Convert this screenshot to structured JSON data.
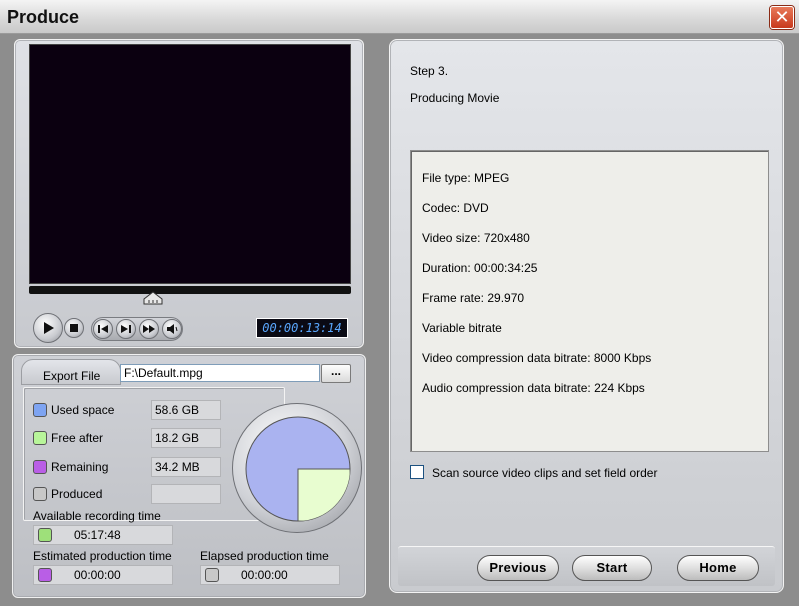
{
  "window": {
    "title": "Produce",
    "close_label": "✕"
  },
  "player": {
    "timecode": "00:00:13:14",
    "buttons": [
      "play-icon",
      "stop-icon",
      "previous-frame-icon",
      "next-frame-icon",
      "fast-forward-icon",
      "volume-icon"
    ]
  },
  "export": {
    "label": "Export File",
    "path": "F:\\Default.mpg",
    "browse_label": "..."
  },
  "disk": {
    "used_space": {
      "label": "Used space",
      "value": "58.6  GB",
      "color": "#7ea4f2"
    },
    "free_after": {
      "label": "Free after",
      "value": "18.2  GB",
      "color": "#b8f59a"
    },
    "remaining": {
      "label": "Remaining",
      "value": "34.2  MB",
      "color": "#b95ee6"
    },
    "produced": {
      "label": "Produced",
      "value": "",
      "color": "#c8c8c8"
    },
    "pie": {
      "used_fraction": 0.75,
      "free_fraction": 0.25,
      "used_color": "#aab3f0",
      "free_color": "#e8fdd0"
    }
  },
  "times": {
    "available_label": "Available recording time",
    "available_value": "05:17:48",
    "available_color": "#9ee07a",
    "estimated_label": "Estimated production time",
    "estimated_value": "00:00:00",
    "estimated_color": "#b95ee6",
    "elapsed_label": "Elapsed production time",
    "elapsed_value": "00:00:00",
    "elapsed_color": "#c8c8c8"
  },
  "wizard": {
    "step": "Step 3.",
    "title": "Producing Movie",
    "info": [
      "File type: MPEG",
      "Codec: DVD",
      "Video size: 720x480",
      "Duration: 00:00:34:25",
      "Frame rate: 29.970",
      "Variable bitrate",
      "Video compression data bitrate: 8000 Kbps",
      "Audio compression data bitrate: 224 Kbps"
    ],
    "scan_label": "Scan source video clips and set field order",
    "scan_checked": false,
    "buttons": {
      "previous": "Previous",
      "start": "Start",
      "home": "Home"
    }
  }
}
